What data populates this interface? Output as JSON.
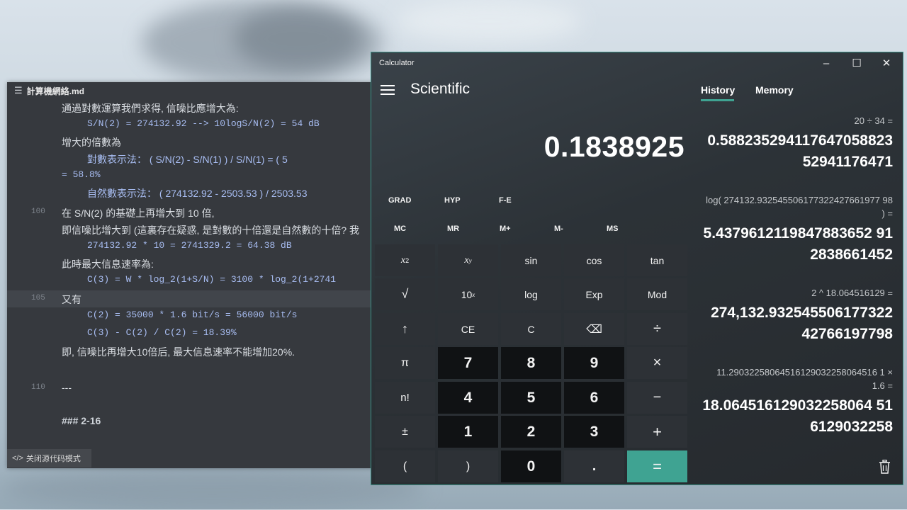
{
  "editor": {
    "file_name": "計算機網絡.md",
    "status_label": "关闭源代码模式",
    "lines": [
      {
        "num": "",
        "text": "通過對數運算我們求得, 信噪比應增大為:"
      },
      {
        "num": "",
        "text": "S/N(2) = 274132.92 --> 10logS/N(2) = 54 dB"
      },
      {
        "num": "",
        "text": "增大的倍數為"
      },
      {
        "num": "",
        "text": "對數表示法： ( S/N(2) - S/N(1) ) / S/N(1) = ( 5"
      },
      {
        "num": "",
        "text": "= 58.8%"
      },
      {
        "num": "",
        "text": "自然數表示法： ( 274132.92 - 2503.53 ) / 2503.53"
      },
      {
        "num": "100",
        "text": "在 S/N(2) 的基礎上再增大到 10 倍,"
      },
      {
        "num": "",
        "text": "即信噪比增大到 (這裏存在疑惑, 是對數的十倍還是自然數的十倍? 我"
      },
      {
        "num": "",
        "text": "274132.92 * 10 = 2741329.2 = 64.38 dB"
      },
      {
        "num": "",
        "text": "此時最大信息速率為:"
      },
      {
        "num": "",
        "text": "C(3) = W * log_2(1+S/N) = 3100 * log_2(1+2741"
      },
      {
        "num": "105",
        "text": "又有"
      },
      {
        "num": "",
        "text": "C(2) = 35000 * 1.6 bit/s = 56000 bit/s"
      },
      {
        "num": "",
        "text": "C(3) - C(2) / C(2) = 18.39%"
      },
      {
        "num": "",
        "text": "即, 信噪比再增大10倍后, 最大信息速率不能增加20%."
      },
      {
        "num": "110",
        "text": "---"
      },
      {
        "num": "",
        "text": "### 2-16"
      }
    ]
  },
  "calc": {
    "window_title": "Calculator",
    "mode": "Scientific",
    "display": "0.1838925",
    "angle_mode": "GRAD",
    "hyp": "HYP",
    "fe": "F-E",
    "memory_buttons": [
      "MC",
      "MR",
      "M+",
      "M-",
      "MS"
    ],
    "keys": {
      "sin": "sin",
      "cos": "cos",
      "tan": "tan",
      "sqrt": "√",
      "ten_pow": "10",
      "ten_pow_sup": "x",
      "log": "log",
      "exp": "Exp",
      "mod": "Mod",
      "shift": "↑",
      "ce": "CE",
      "c": "C",
      "backspace": "⌫",
      "divide": "÷",
      "pi": "π",
      "seven": "7",
      "eight": "8",
      "nine": "9",
      "multiply": "×",
      "fact": "n!",
      "four": "4",
      "five": "5",
      "six": "6",
      "minus": "−",
      "negate": "±",
      "one": "1",
      "two": "2",
      "three": "3",
      "plus": "+",
      "lparen": "(",
      "rparen": ")",
      "zero": "0",
      "dot": ".",
      "equals": "=",
      "x_sq_base": "x",
      "x_sq_exp": "2",
      "x_pow_base": "x",
      "x_pow_exp": "y"
    },
    "tabs": {
      "history": "History",
      "memory": "Memory"
    },
    "history": [
      {
        "expr": "20  ÷  34 =",
        "result_1": "0.588235294117647058823",
        "result_2": "52941176471"
      },
      {
        "expr_1": "log( 274132.932545506177322427661977 98",
        "expr_2": ") =",
        "result_1": "5.4379612119847883652 91",
        "result_2": "2838661452"
      },
      {
        "expr": "2  ^  18.064516129 =",
        "result_1": "274,132.932545506177322",
        "result_2": "42766197798"
      },
      {
        "expr_1": "11.29032258064516129032258064516 1  ×",
        "expr_2": "1.6 =",
        "result_1": "18.064516129032258064 51",
        "result_2": "6129032258"
      }
    ]
  }
}
